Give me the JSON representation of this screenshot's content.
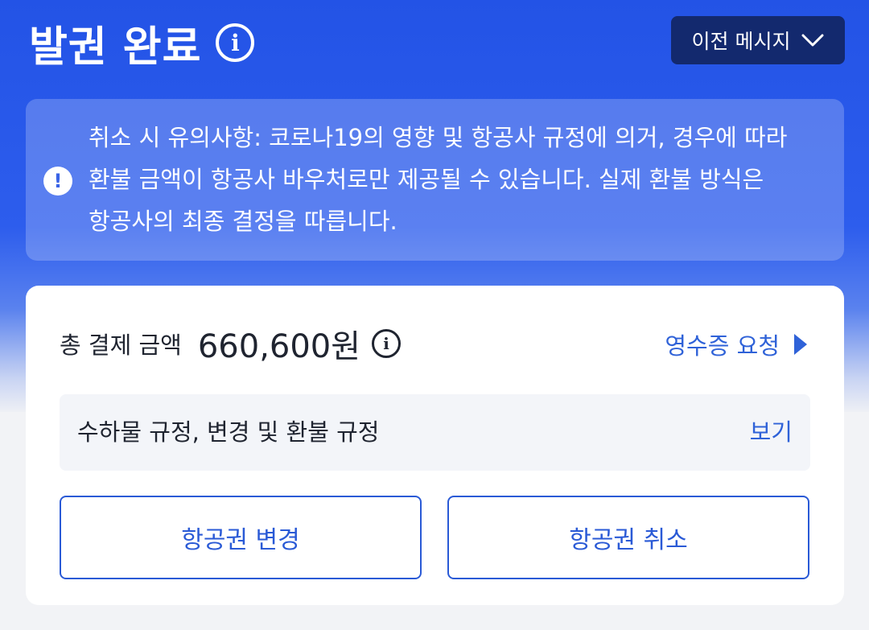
{
  "header": {
    "title": "발권 완료",
    "info_icon": "info-icon",
    "prev_message_label": "이전 메시지",
    "prev_message_icon": "chevron-down-icon"
  },
  "notice": {
    "icon": "exclamation-icon",
    "text": "취소 시 유의사항: 코로나19의 영향 및 항공사 규정에 의거, 경우에 따라 환불 금액이 항공사 바우처로만 제공될 수 있습니다. 실제 환불 방식은 항공사의 최종 결정을 따릅니다."
  },
  "payment": {
    "total_label": "총 결제 금액",
    "total_amount": "660,600원",
    "info_icon": "info-icon",
    "receipt_link": "영수증 요청",
    "receipt_icon": "play-icon"
  },
  "rules": {
    "label": "수하물 규정, 변경 및 환불 규정",
    "view_link": "보기"
  },
  "actions": {
    "change_ticket": "항공권 변경",
    "cancel_ticket": "항공권 취소"
  },
  "colors": {
    "hero_blue": "#2353e6",
    "prev_button_bg": "#13296e",
    "accent_blue": "#2f62d8",
    "text_dark": "#1f2430"
  }
}
